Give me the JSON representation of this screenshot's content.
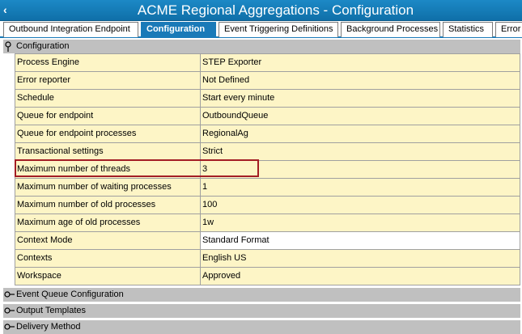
{
  "window": {
    "title": "ACME Regional Aggregations - Configuration"
  },
  "tabs": [
    {
      "label": "Outbound Integration Endpoint",
      "active": false
    },
    {
      "label": "Configuration",
      "active": true
    },
    {
      "label": "Event Triggering Definitions",
      "active": false
    },
    {
      "label": "Background Processes",
      "active": false
    },
    {
      "label": "Statistics",
      "active": false
    },
    {
      "label": "Error",
      "active": false
    }
  ],
  "configuration": {
    "section_label": "Configuration",
    "rows": [
      {
        "name": "Process Engine",
        "value": "STEP Exporter"
      },
      {
        "name": "Error reporter",
        "value": "Not Defined"
      },
      {
        "name": "Schedule",
        "value": "Start every minute"
      },
      {
        "name": "Queue for endpoint",
        "value": "OutboundQueue"
      },
      {
        "name": "Queue for endpoint processes",
        "value": "RegionalAg"
      },
      {
        "name": "Transactional settings",
        "value": "Strict"
      },
      {
        "name": "Maximum number of threads",
        "value": "3"
      },
      {
        "name": "Maximum number of waiting processes",
        "value": "1"
      },
      {
        "name": "Maximum number of old processes",
        "value": "100"
      },
      {
        "name": "Maximum age of old processes",
        "value": "1w"
      },
      {
        "name": "Context Mode",
        "value": "Standard Format"
      },
      {
        "name": "Contexts",
        "value": "English US"
      },
      {
        "name": "Workspace",
        "value": "Approved"
      }
    ]
  },
  "collapsed_sections": [
    {
      "label": "Event Queue Configuration"
    },
    {
      "label": "Output Templates"
    },
    {
      "label": "Delivery Method"
    }
  ],
  "colors": {
    "title_bar": "#1a7ab8",
    "row_background": "#fdf5c6",
    "section_background": "#c0c0c0",
    "highlight_border": "#a31d24"
  }
}
